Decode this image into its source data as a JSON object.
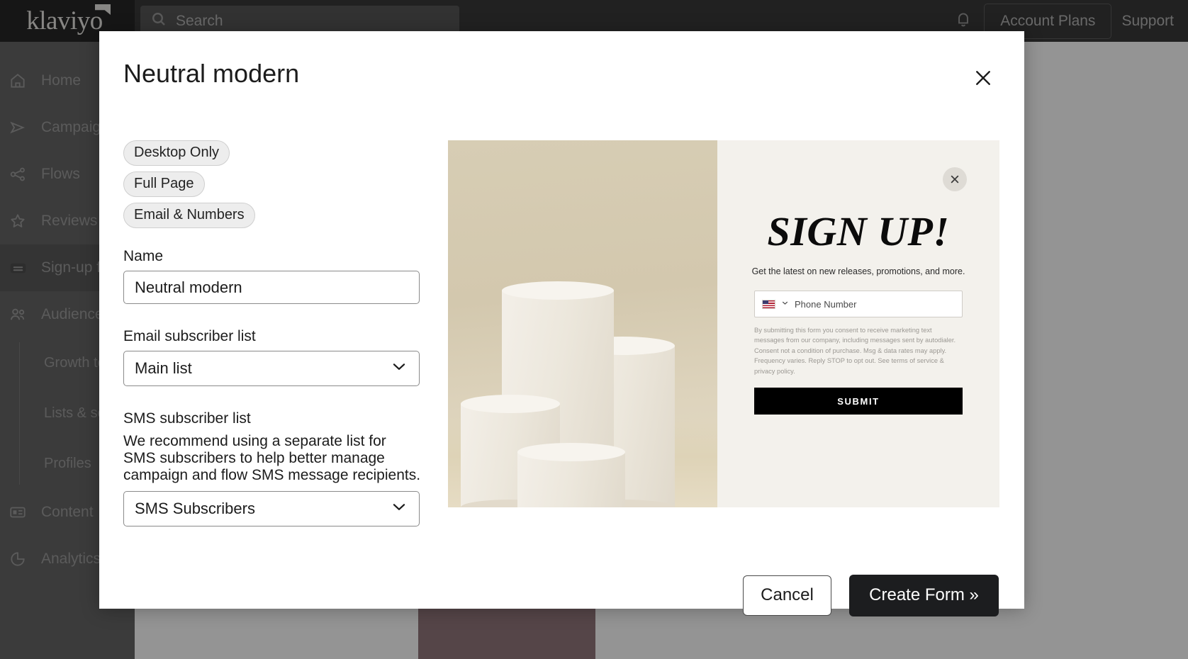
{
  "app": {
    "brand": "klaviyo",
    "search": {
      "placeholder": "Search"
    },
    "topbar": {
      "account_plans": "Account Plans",
      "support": "Support"
    },
    "sidebar": {
      "items": [
        {
          "label": "Home",
          "icon": "home-icon"
        },
        {
          "label": "Campaigns",
          "icon": "send-icon"
        },
        {
          "label": "Flows",
          "icon": "flows-icon"
        },
        {
          "label": "Reviews",
          "icon": "star-icon"
        },
        {
          "label": "Sign-up forms",
          "icon": "form-icon",
          "active": true
        },
        {
          "label": "Audience",
          "icon": "people-icon"
        }
      ],
      "sub_items": [
        {
          "label": "Growth tools"
        },
        {
          "label": "Lists & segments"
        },
        {
          "label": "Profiles"
        }
      ],
      "items_after": [
        {
          "label": "Content",
          "icon": "content-icon"
        },
        {
          "label": "Analytics",
          "icon": "analytics-icon"
        }
      ]
    }
  },
  "modal": {
    "title": "Neutral modern",
    "close_icon": "close-icon",
    "tags": [
      "Desktop Only",
      "Full Page",
      "Email & Numbers"
    ],
    "fields": {
      "name": {
        "label": "Name",
        "value": "Neutral modern"
      },
      "email_list": {
        "label": "Email subscriber list",
        "value": "Main list",
        "chevron": "chevron-down-icon"
      },
      "sms_list": {
        "label": "SMS subscriber list",
        "help": "We recommend using a separate list for SMS subscribers to help better manage campaign and flow SMS message recipients.",
        "value": "SMS Subscribers",
        "chevron": "chevron-down-icon"
      }
    },
    "footer": {
      "cancel": "Cancel",
      "create": "Create Form »"
    }
  },
  "preview": {
    "close_icon": "close-icon",
    "heading": "SIGN UP!",
    "subheading": "Get the latest on new releases, promotions, and more.",
    "phone_placeholder": "Phone Number",
    "country_flag": "us-flag-icon",
    "country_chevron": "chevron-down-icon",
    "fine_print": "By submitting this form you consent to receive marketing text messages from our company, including messages sent by autodialer. Consent not a condition of purchase. Msg & data rates may apply. Frequency varies. Reply STOP to opt out. See terms of service & privacy policy.",
    "submit": "SUBMIT"
  },
  "colors": {
    "topbar_bg": "#3a3a3a",
    "sidebar_bg": "#666666",
    "logo_bg": "#262626",
    "primary_button": "#1c1d1f",
    "preview_panel_bg": "#f3f1ec",
    "preview_photo_bg": "#d5cab1"
  }
}
